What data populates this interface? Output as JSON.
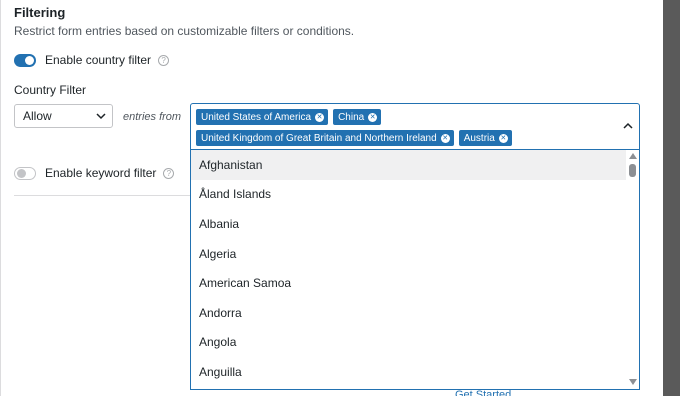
{
  "section": {
    "title": "Filtering",
    "subtitle": "Restrict form entries based on customizable filters or conditions."
  },
  "country_toggle": {
    "label": "Enable country filter",
    "state": "on",
    "help": "?"
  },
  "country_filter": {
    "label": "Country Filter",
    "mode_selected": "Allow",
    "entries_text": "entries from",
    "selected": [
      "United States of America",
      "China",
      "United Kingdom of Great Britain and Northern Ireland",
      "Austria"
    ],
    "options": [
      "Afghanistan",
      "Åland Islands",
      "Albania",
      "Algeria",
      "American Samoa",
      "Andorra",
      "Angola",
      "Anguilla"
    ],
    "highlighted_option": "Afghanistan"
  },
  "keyword_toggle": {
    "label": "Enable keyword filter",
    "state": "off",
    "help": "?"
  },
  "partial_link": "Get Started",
  "colors": {
    "accent": "#2271b1",
    "toggle_off": "#c3c4c7",
    "highlight": "#f0f0f1"
  }
}
